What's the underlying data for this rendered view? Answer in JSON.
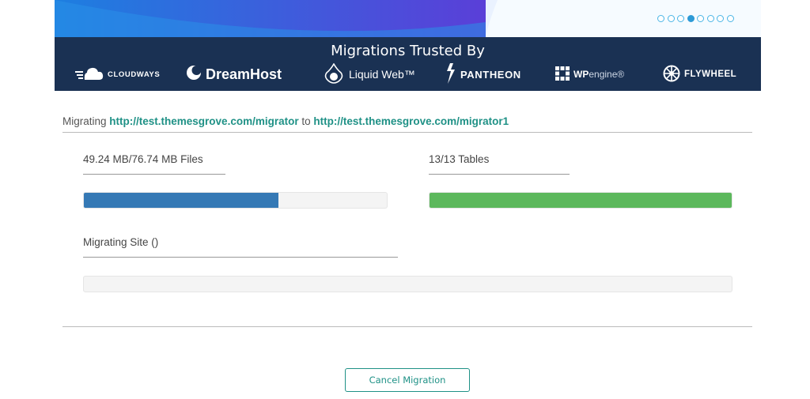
{
  "hero": {
    "slide_count": 8,
    "active_slide": 4
  },
  "trusted": {
    "title": "Migrations Trusted By",
    "logos": {
      "cloudways": "CLOUDWAYS",
      "dreamhost": "DreamHost",
      "liquidweb": "Liquid Web™",
      "pantheon": "PANTHEON",
      "wpengine_bold": "WP",
      "wpengine_light": "engine®",
      "flywheel": "FLYWHEEL"
    }
  },
  "migration": {
    "prefix": "Migrating",
    "source_url": "http://test.themesgrove.com/migrator",
    "joiner": "to",
    "target_url": "http://test.themesgrove.com/migrator1",
    "files_label": "49.24 MB/76.74 MB Files",
    "files_progress": 0.6417,
    "tables_label": "13/13 Tables",
    "tables_progress": 1.0,
    "site_label": "Migrating Site ()",
    "site_progress": 0.0
  },
  "colors": {
    "files_bar": "#3579b5",
    "tables_bar": "#5cb85c",
    "link": "#1f9186",
    "band": "#1a3153"
  },
  "actions": {
    "cancel_label": "Cancel Migration"
  }
}
